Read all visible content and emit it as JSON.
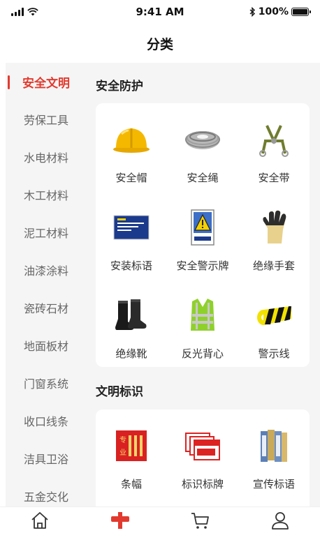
{
  "status_bar": {
    "time": "9:41 AM",
    "battery": "100%"
  },
  "nav": {
    "title": "分类"
  },
  "sidebar": {
    "items": [
      {
        "label": "安全文明",
        "active": true
      },
      {
        "label": "劳保工具"
      },
      {
        "label": "水电材料"
      },
      {
        "label": "木工材料"
      },
      {
        "label": "泥工材料"
      },
      {
        "label": "油漆涂料"
      },
      {
        "label": "瓷砖石材"
      },
      {
        "label": "地面板材"
      },
      {
        "label": "门窗系统"
      },
      {
        "label": "收口线条"
      },
      {
        "label": "洁具卫浴"
      },
      {
        "label": "五金交化"
      }
    ]
  },
  "sections": [
    {
      "title": "安全防护",
      "items": [
        {
          "label": "安全帽",
          "icon": "helmet-icon"
        },
        {
          "label": "安全绳",
          "icon": "rope-icon"
        },
        {
          "label": "安全带",
          "icon": "harness-icon"
        },
        {
          "label": "安装标语",
          "icon": "sign-board-icon"
        },
        {
          "label": "安全警示牌",
          "icon": "warning-sign-icon"
        },
        {
          "label": "绝缘手套",
          "icon": "glove-icon"
        },
        {
          "label": "绝缘靴",
          "icon": "boots-icon"
        },
        {
          "label": "反光背心",
          "icon": "vest-icon"
        },
        {
          "label": "警示线",
          "icon": "caution-tape-icon"
        }
      ]
    },
    {
      "title": "文明标识",
      "items": [
        {
          "label": "条幅",
          "icon": "banner-icon"
        },
        {
          "label": "标识标牌",
          "icon": "signage-icon"
        },
        {
          "label": "宣传标语",
          "icon": "poster-icon"
        }
      ]
    }
  ],
  "tabbar": {
    "items": [
      "home-icon",
      "category-icon",
      "cart-icon",
      "profile-icon"
    ],
    "active_color": "#e23a2e"
  }
}
